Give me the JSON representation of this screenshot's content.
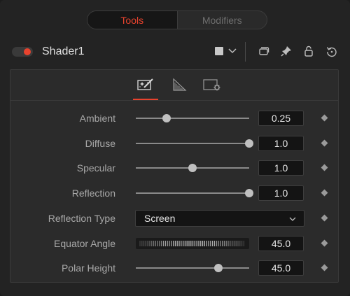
{
  "top_tabs": [
    {
      "label": "Tools",
      "active": true
    },
    {
      "label": "Modifiers",
      "active": false
    }
  ],
  "node": {
    "name": "Shader1",
    "enabled": true,
    "color_swatch": "#c8c8c8",
    "header_icons": [
      "chevron-down-icon",
      "version-icon",
      "pin-icon",
      "lock-icon",
      "reset-icon"
    ]
  },
  "sub_tabs": [
    {
      "icon": "magic-wand-icon",
      "active": true
    },
    {
      "icon": "ramp-icon",
      "active": false
    },
    {
      "icon": "settings-panel-icon",
      "active": false
    }
  ],
  "controls": [
    {
      "label": "Ambient",
      "type": "slider",
      "value": "0.25",
      "level": 0.27
    },
    {
      "label": "Diffuse",
      "type": "slider",
      "value": "1.0",
      "level": 1.0
    },
    {
      "label": "Specular",
      "type": "slider",
      "value": "1.0",
      "level": 0.5
    },
    {
      "label": "Reflection",
      "type": "slider",
      "value": "1.0",
      "level": 1.0
    },
    {
      "label": "Reflection Type",
      "type": "dropdown",
      "value": "Screen"
    },
    {
      "label": "Equator Angle",
      "type": "thumbwheel",
      "value": "45.0"
    },
    {
      "label": "Polar Height",
      "type": "slider",
      "value": "45.0",
      "level": 0.73
    }
  ],
  "accent_color": "#e8432e"
}
